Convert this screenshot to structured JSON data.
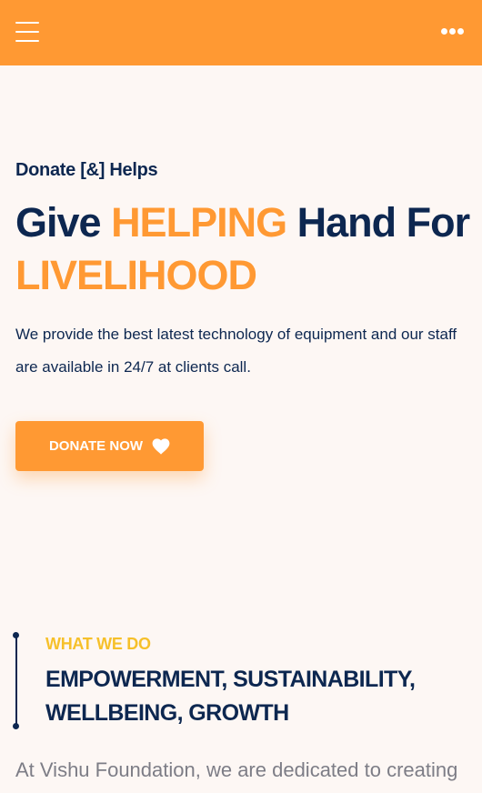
{
  "header": {
    "menu_icon": "hamburger-icon",
    "more_icon": "more-dots-icon",
    "background_color": "#ff9933"
  },
  "hero": {
    "eyebrow": "Donate [&] Helps",
    "headline": {
      "part1": "Give ",
      "part2": "HELPING",
      "part3": " Hand For ",
      "part4": "LIVELIHOOD"
    },
    "intro": "We provide the best latest technology of equipment and our staff are available in 24/7 at clients call.",
    "button_label": "DONATE NOW",
    "button_icon": "heart-icon"
  },
  "what_we_do": {
    "label": "WHAT WE DO",
    "title": "EMPOWERMENT, SUSTAINABILITY, WELLBEING, GROWTH",
    "intro": "At Vishu Foundation, we are dedicated to creating"
  },
  "colors": {
    "accent": "#ff9933",
    "navy": "#0d2750",
    "yellow": "#f6c02a",
    "background": "#fdf7f4",
    "muted_text": "#7d7d86"
  }
}
